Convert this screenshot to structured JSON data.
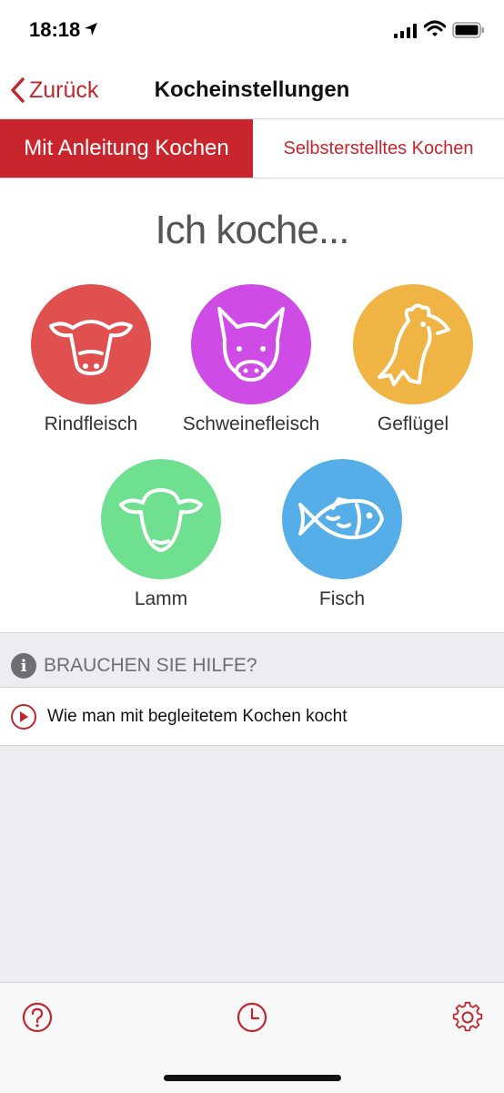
{
  "status_bar": {
    "time": "18:18"
  },
  "nav": {
    "back_label": "Zurück",
    "title": "Kocheinstellungen"
  },
  "segments": {
    "active": "Mit Anleitung Kochen",
    "inactive": "Selbsterstelltes Kochen"
  },
  "heading": "Ich koche...",
  "animals": [
    {
      "label": "Rindfleisch",
      "color": "#e0504f",
      "icon": "cow-icon"
    },
    {
      "label": "Schweinefleisch",
      "color": "#cf4be6",
      "icon": "pig-icon"
    },
    {
      "label": "Geflügel",
      "color": "#f0b445",
      "icon": "chicken-icon"
    },
    {
      "label": "Lamm",
      "color": "#6fe08f",
      "icon": "sheep-icon"
    },
    {
      "label": "Fisch",
      "color": "#55aee8",
      "icon": "fish-icon"
    }
  ],
  "help": {
    "title": "BRAUCHEN SIE HILFE?",
    "rows": [
      {
        "label": "Wie man mit begleitetem Kochen kocht"
      }
    ]
  },
  "tab_bar": {
    "icons": [
      "help-icon",
      "timer-icon",
      "settings-icon"
    ]
  },
  "colors": {
    "accent": "#c8262c",
    "background_gray": "#ececf1"
  }
}
